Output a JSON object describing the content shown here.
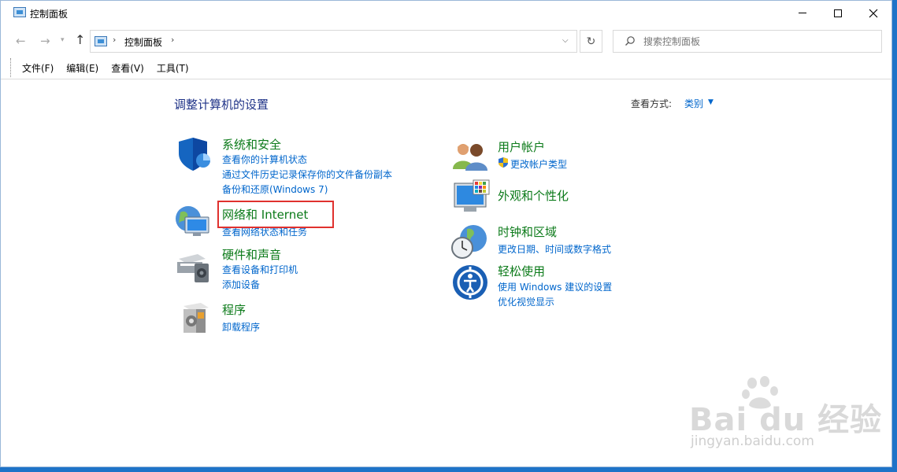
{
  "window": {
    "title": "控制面板"
  },
  "navigation": {
    "breadcrumb_item": "控制面板",
    "search_placeholder": "搜索控制面板",
    "back_glyph": "←",
    "forward_glyph": "→",
    "up_glyph": "↑",
    "refresh_glyph": "↻",
    "separator_glyph": "›"
  },
  "menu": {
    "file": "文件(F)",
    "edit": "编辑(E)",
    "view": "查看(V)",
    "tools": "工具(T)"
  },
  "main": {
    "heading": "调整计算机的设置",
    "view_by_label": "查看方式:",
    "view_by_value": "类别"
  },
  "categories": {
    "system": {
      "title": "系统和安全",
      "links": [
        "查看你的计算机状态",
        "通过文件历史记录保存你的文件备份副本",
        "备份和还原(Windows 7)"
      ]
    },
    "network": {
      "title": "网络和 Internet",
      "links": [
        "查看网络状态和任务"
      ]
    },
    "hardware": {
      "title": "硬件和声音",
      "links": [
        "查看设备和打印机",
        "添加设备"
      ]
    },
    "programs": {
      "title": "程序",
      "links": [
        "卸载程序"
      ]
    },
    "accounts": {
      "title": "用户帐户",
      "links": [
        "更改帐户类型"
      ]
    },
    "appearance": {
      "title": "外观和个性化",
      "links": []
    },
    "clock": {
      "title": "时钟和区域",
      "links": [
        "更改日期、时间或数字格式"
      ]
    },
    "ease": {
      "title": "轻松使用",
      "links": [
        "使用 Windows 建议的设置",
        "优化视觉显示"
      ]
    }
  },
  "watermark": {
    "brand": "Bai du 经验",
    "url": "jingyan.baidu.com"
  },
  "colors": {
    "category_title": "#0b7a19",
    "link": "#0066cc",
    "heading": "#1e3287",
    "highlight": "#e0312e"
  }
}
